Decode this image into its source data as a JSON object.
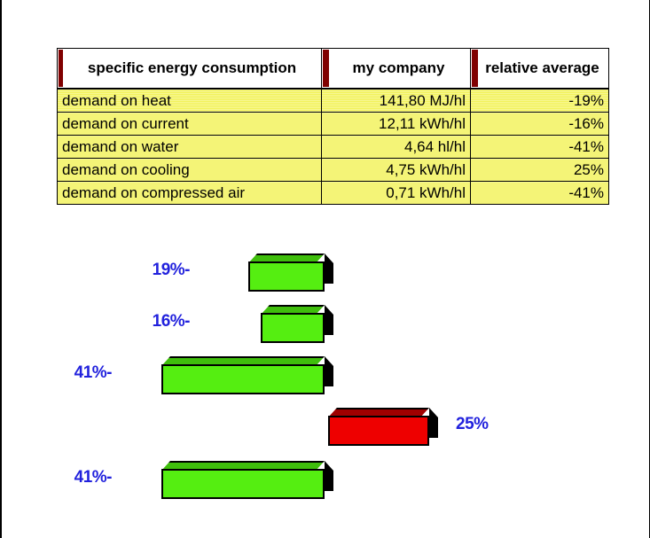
{
  "page": {
    "background_color": "#ffffff",
    "border_color": "#000000"
  },
  "table": {
    "header_accent_color": "#800000",
    "row_background_color": "#f2f25a",
    "columns": [
      "specific energy consumption",
      "my company",
      "relative average"
    ],
    "rows": [
      {
        "name": "demand on heat",
        "value": "141,80 MJ/hl",
        "relative": "-19%"
      },
      {
        "name": "demand on current",
        "value": "12,11 kWh/hl",
        "relative": "-16%"
      },
      {
        "name": "demand on water",
        "value": "4,64 hl/hl",
        "relative": "-41%"
      },
      {
        "name": "demand on cooling",
        "value": "4,75 kWh/hl",
        "relative": "25%"
      },
      {
        "name": "demand on compressed air",
        "value": "0,71 kWh/hl",
        "relative": "-41%"
      }
    ]
  },
  "chart_data": {
    "type": "bar",
    "title": "",
    "xlabel": "",
    "ylabel": "",
    "orientation": "horizontal",
    "grid": false,
    "legend": false,
    "baseline_value": 0,
    "label_color": "#2222dd",
    "negative_color": "#55ee11",
    "positive_color": "#ee0000",
    "categories": [
      "demand on heat",
      "demand on current",
      "demand on water",
      "demand on cooling",
      "demand on compressed air"
    ],
    "values": [
      -19,
      -16,
      -41,
      25,
      -41
    ],
    "data_labels": [
      "19%-",
      "16%-",
      "41%-",
      "25%",
      "41%-"
    ],
    "bars": [
      {
        "label": "19%-",
        "value": -19,
        "color": "#55ee11",
        "direction": "left",
        "label_side": "left"
      },
      {
        "label": "16%-",
        "value": -16,
        "color": "#55ee11",
        "direction": "left",
        "label_side": "left"
      },
      {
        "label": "41%-",
        "value": -41,
        "color": "#55ee11",
        "direction": "left",
        "label_side": "left"
      },
      {
        "label": "25%",
        "value": 25,
        "color": "#ee0000",
        "direction": "right",
        "label_side": "right"
      },
      {
        "label": "41%-",
        "value": -41,
        "color": "#55ee11",
        "direction": "left",
        "label_side": "left"
      }
    ]
  }
}
